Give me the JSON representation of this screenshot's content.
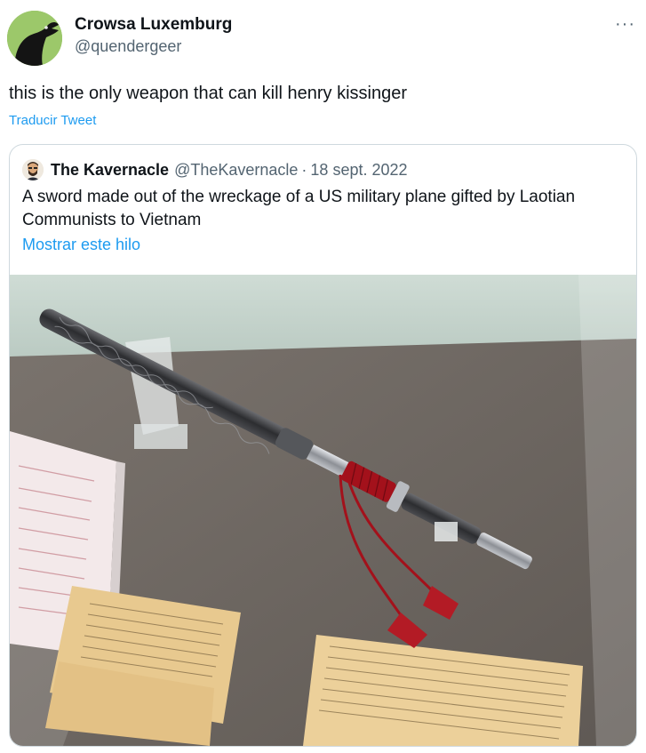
{
  "author": {
    "name": "Crowsa Luxemburg",
    "handle": "@quendergeer",
    "avatar_icon": "crow-avatar-icon"
  },
  "more_icon": "more-options-icon",
  "more_glyph": "···",
  "tweet": {
    "text": "this is the only weapon that can kill henry kissinger",
    "translate_label": "Traducir Tweet"
  },
  "quote": {
    "name": "The Kavernacle",
    "handle": "@TheKavernacle",
    "separator": "·",
    "date": "18 sept. 2022",
    "text": "A sword made out of the wreckage of a US military plane gifted by Laotian Communists to Vietnam",
    "show_thread_label": "Mostrar este hilo",
    "avatar_icon": "cartoon-avatar-icon",
    "photo": {
      "description_icon": "sword-museum-photo",
      "colors": {
        "wall": "#c8d6cf",
        "felt": "#6e6863",
        "scabbard": "#3a3b3e",
        "tassel": "#b31b25",
        "plaque": "#e8c98f"
      }
    }
  },
  "colors": {
    "link": "#1d9bf0",
    "text": "#0f1419",
    "muted": "#536471",
    "border": "#cfd9de"
  }
}
